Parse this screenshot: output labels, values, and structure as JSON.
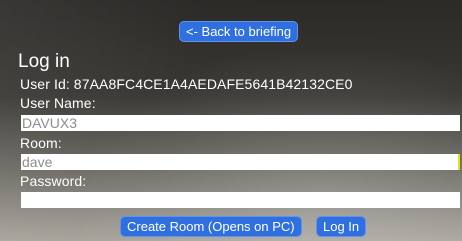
{
  "nav": {
    "back_label": "<- Back to briefing"
  },
  "login": {
    "title": "Log in",
    "user_id_text": "User Id: 87AA8FC4CE1A4AEDAFE5641B42132CE0",
    "username_label": "User Name:",
    "username_value": "DAVUX3",
    "room_label": "Room:",
    "room_value": "dave",
    "password_label": "Password:",
    "password_value": ""
  },
  "actions": {
    "create_room_label": "Create Room (Opens on PC)",
    "login_label": "Log In"
  },
  "colors": {
    "button": "#2f6fe0",
    "field": "#ffffff",
    "caret": "#e6e400"
  }
}
